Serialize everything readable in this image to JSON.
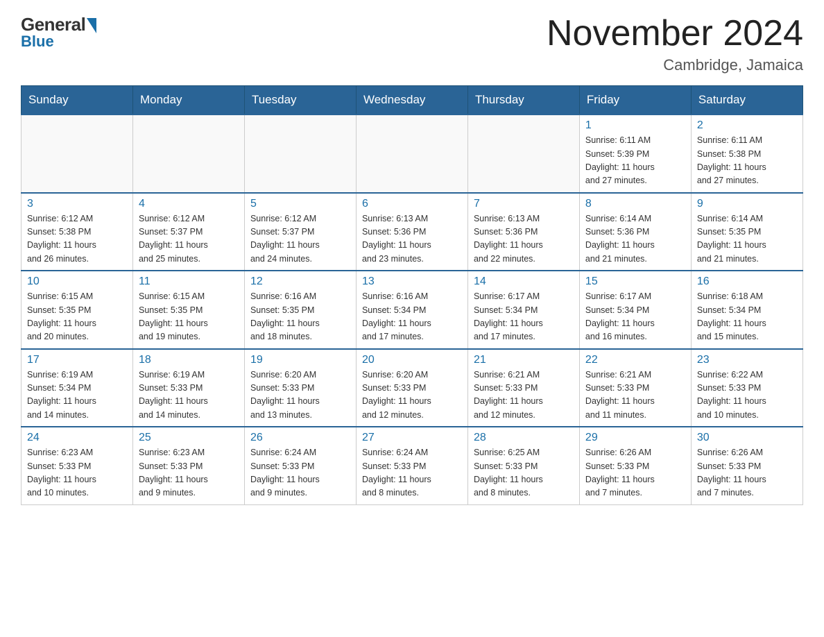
{
  "header": {
    "logo_general": "General",
    "logo_blue": "Blue",
    "month_title": "November 2024",
    "location": "Cambridge, Jamaica"
  },
  "days_of_week": [
    "Sunday",
    "Monday",
    "Tuesday",
    "Wednesday",
    "Thursday",
    "Friday",
    "Saturday"
  ],
  "weeks": [
    [
      {
        "day": "",
        "info": ""
      },
      {
        "day": "",
        "info": ""
      },
      {
        "day": "",
        "info": ""
      },
      {
        "day": "",
        "info": ""
      },
      {
        "day": "",
        "info": ""
      },
      {
        "day": "1",
        "info": "Sunrise: 6:11 AM\nSunset: 5:39 PM\nDaylight: 11 hours\nand 27 minutes."
      },
      {
        "day": "2",
        "info": "Sunrise: 6:11 AM\nSunset: 5:38 PM\nDaylight: 11 hours\nand 27 minutes."
      }
    ],
    [
      {
        "day": "3",
        "info": "Sunrise: 6:12 AM\nSunset: 5:38 PM\nDaylight: 11 hours\nand 26 minutes."
      },
      {
        "day": "4",
        "info": "Sunrise: 6:12 AM\nSunset: 5:37 PM\nDaylight: 11 hours\nand 25 minutes."
      },
      {
        "day": "5",
        "info": "Sunrise: 6:12 AM\nSunset: 5:37 PM\nDaylight: 11 hours\nand 24 minutes."
      },
      {
        "day": "6",
        "info": "Sunrise: 6:13 AM\nSunset: 5:36 PM\nDaylight: 11 hours\nand 23 minutes."
      },
      {
        "day": "7",
        "info": "Sunrise: 6:13 AM\nSunset: 5:36 PM\nDaylight: 11 hours\nand 22 minutes."
      },
      {
        "day": "8",
        "info": "Sunrise: 6:14 AM\nSunset: 5:36 PM\nDaylight: 11 hours\nand 21 minutes."
      },
      {
        "day": "9",
        "info": "Sunrise: 6:14 AM\nSunset: 5:35 PM\nDaylight: 11 hours\nand 21 minutes."
      }
    ],
    [
      {
        "day": "10",
        "info": "Sunrise: 6:15 AM\nSunset: 5:35 PM\nDaylight: 11 hours\nand 20 minutes."
      },
      {
        "day": "11",
        "info": "Sunrise: 6:15 AM\nSunset: 5:35 PM\nDaylight: 11 hours\nand 19 minutes."
      },
      {
        "day": "12",
        "info": "Sunrise: 6:16 AM\nSunset: 5:35 PM\nDaylight: 11 hours\nand 18 minutes."
      },
      {
        "day": "13",
        "info": "Sunrise: 6:16 AM\nSunset: 5:34 PM\nDaylight: 11 hours\nand 17 minutes."
      },
      {
        "day": "14",
        "info": "Sunrise: 6:17 AM\nSunset: 5:34 PM\nDaylight: 11 hours\nand 17 minutes."
      },
      {
        "day": "15",
        "info": "Sunrise: 6:17 AM\nSunset: 5:34 PM\nDaylight: 11 hours\nand 16 minutes."
      },
      {
        "day": "16",
        "info": "Sunrise: 6:18 AM\nSunset: 5:34 PM\nDaylight: 11 hours\nand 15 minutes."
      }
    ],
    [
      {
        "day": "17",
        "info": "Sunrise: 6:19 AM\nSunset: 5:34 PM\nDaylight: 11 hours\nand 14 minutes."
      },
      {
        "day": "18",
        "info": "Sunrise: 6:19 AM\nSunset: 5:33 PM\nDaylight: 11 hours\nand 14 minutes."
      },
      {
        "day": "19",
        "info": "Sunrise: 6:20 AM\nSunset: 5:33 PM\nDaylight: 11 hours\nand 13 minutes."
      },
      {
        "day": "20",
        "info": "Sunrise: 6:20 AM\nSunset: 5:33 PM\nDaylight: 11 hours\nand 12 minutes."
      },
      {
        "day": "21",
        "info": "Sunrise: 6:21 AM\nSunset: 5:33 PM\nDaylight: 11 hours\nand 12 minutes."
      },
      {
        "day": "22",
        "info": "Sunrise: 6:21 AM\nSunset: 5:33 PM\nDaylight: 11 hours\nand 11 minutes."
      },
      {
        "day": "23",
        "info": "Sunrise: 6:22 AM\nSunset: 5:33 PM\nDaylight: 11 hours\nand 10 minutes."
      }
    ],
    [
      {
        "day": "24",
        "info": "Sunrise: 6:23 AM\nSunset: 5:33 PM\nDaylight: 11 hours\nand 10 minutes."
      },
      {
        "day": "25",
        "info": "Sunrise: 6:23 AM\nSunset: 5:33 PM\nDaylight: 11 hours\nand 9 minutes."
      },
      {
        "day": "26",
        "info": "Sunrise: 6:24 AM\nSunset: 5:33 PM\nDaylight: 11 hours\nand 9 minutes."
      },
      {
        "day": "27",
        "info": "Sunrise: 6:24 AM\nSunset: 5:33 PM\nDaylight: 11 hours\nand 8 minutes."
      },
      {
        "day": "28",
        "info": "Sunrise: 6:25 AM\nSunset: 5:33 PM\nDaylight: 11 hours\nand 8 minutes."
      },
      {
        "day": "29",
        "info": "Sunrise: 6:26 AM\nSunset: 5:33 PM\nDaylight: 11 hours\nand 7 minutes."
      },
      {
        "day": "30",
        "info": "Sunrise: 6:26 AM\nSunset: 5:33 PM\nDaylight: 11 hours\nand 7 minutes."
      }
    ]
  ]
}
